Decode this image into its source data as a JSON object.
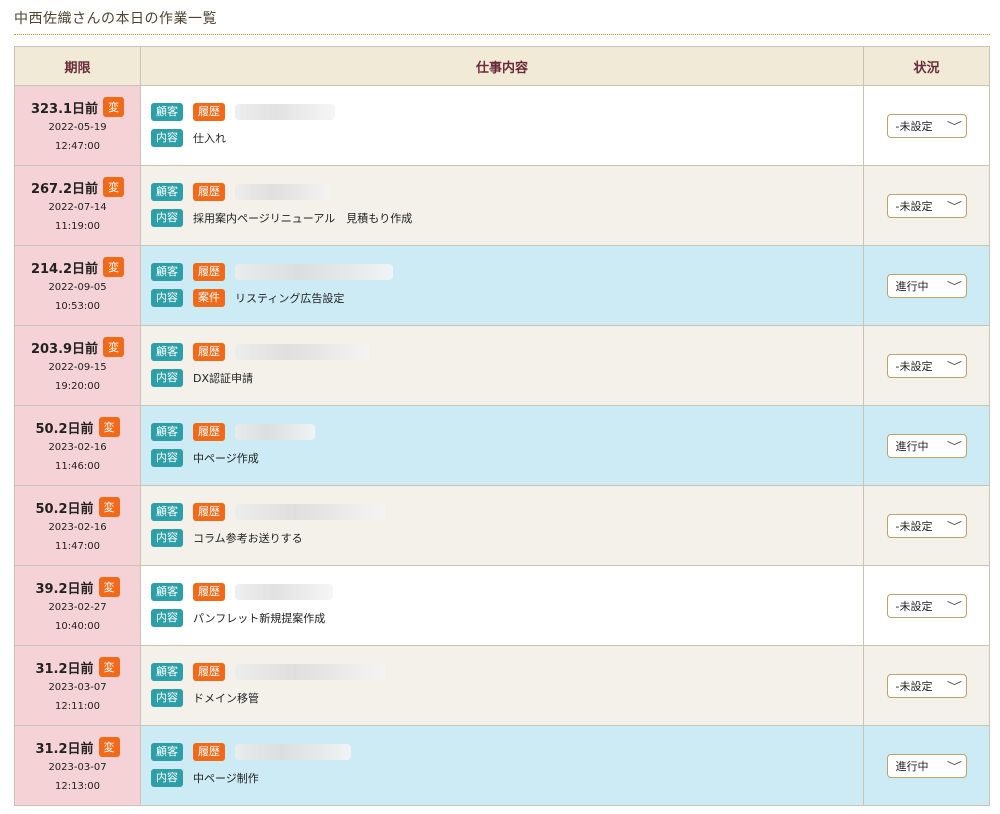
{
  "page": {
    "title": "中西佐織さんの本日の作業一覧"
  },
  "header": {
    "due": "期限",
    "content": "仕事内容",
    "status": "状況"
  },
  "labels": {
    "change": "変",
    "customer": "顧客",
    "history": "履歴",
    "content": "内容",
    "project": "案件",
    "chevron": "﹀"
  },
  "colors": {
    "teal": "#2d9fa8",
    "orange": "#f06a1a",
    "due_bg": "#f4d2d6",
    "row_blue": "#cdebf4",
    "row_beige": "#f3f1ea"
  },
  "rows": [
    {
      "days": "323.1日前",
      "date": "2022-05-19",
      "time": "12:47:00",
      "task": "仕入れ",
      "has_project": false,
      "status": "-未設定",
      "row_color": "white"
    },
    {
      "days": "267.2日前",
      "date": "2022-07-14",
      "time": "11:19:00",
      "task": "採用案内ページリニューアル　見積もり作成",
      "has_project": false,
      "status": "-未設定",
      "row_color": "beige"
    },
    {
      "days": "214.2日前",
      "date": "2022-09-05",
      "time": "10:53:00",
      "task": "リスティング広告設定",
      "has_project": true,
      "status": "進行中",
      "row_color": "blue"
    },
    {
      "days": "203.9日前",
      "date": "2022-09-15",
      "time": "19:20:00",
      "task": "DX認証申請",
      "has_project": false,
      "status": "-未設定",
      "row_color": "beige"
    },
    {
      "days": "50.2日前",
      "date": "2023-02-16",
      "time": "11:46:00",
      "task": "中ページ作成",
      "has_project": false,
      "status": "進行中",
      "row_color": "blue"
    },
    {
      "days": "50.2日前",
      "date": "2023-02-16",
      "time": "11:47:00",
      "task": "コラム参考お送りする",
      "has_project": false,
      "status": "-未設定",
      "row_color": "beige"
    },
    {
      "days": "39.2日前",
      "date": "2023-02-27",
      "time": "10:40:00",
      "task": "パンフレット新規提案作成",
      "has_project": false,
      "status": "-未設定",
      "row_color": "white"
    },
    {
      "days": "31.2日前",
      "date": "2023-03-07",
      "time": "12:11:00",
      "task": "ドメイン移管",
      "has_project": false,
      "status": "-未設定",
      "row_color": "beige"
    },
    {
      "days": "31.2日前",
      "date": "2023-03-07",
      "time": "12:13:00",
      "task": "中ページ制作",
      "has_project": false,
      "status": "進行中",
      "row_color": "blue"
    }
  ]
}
